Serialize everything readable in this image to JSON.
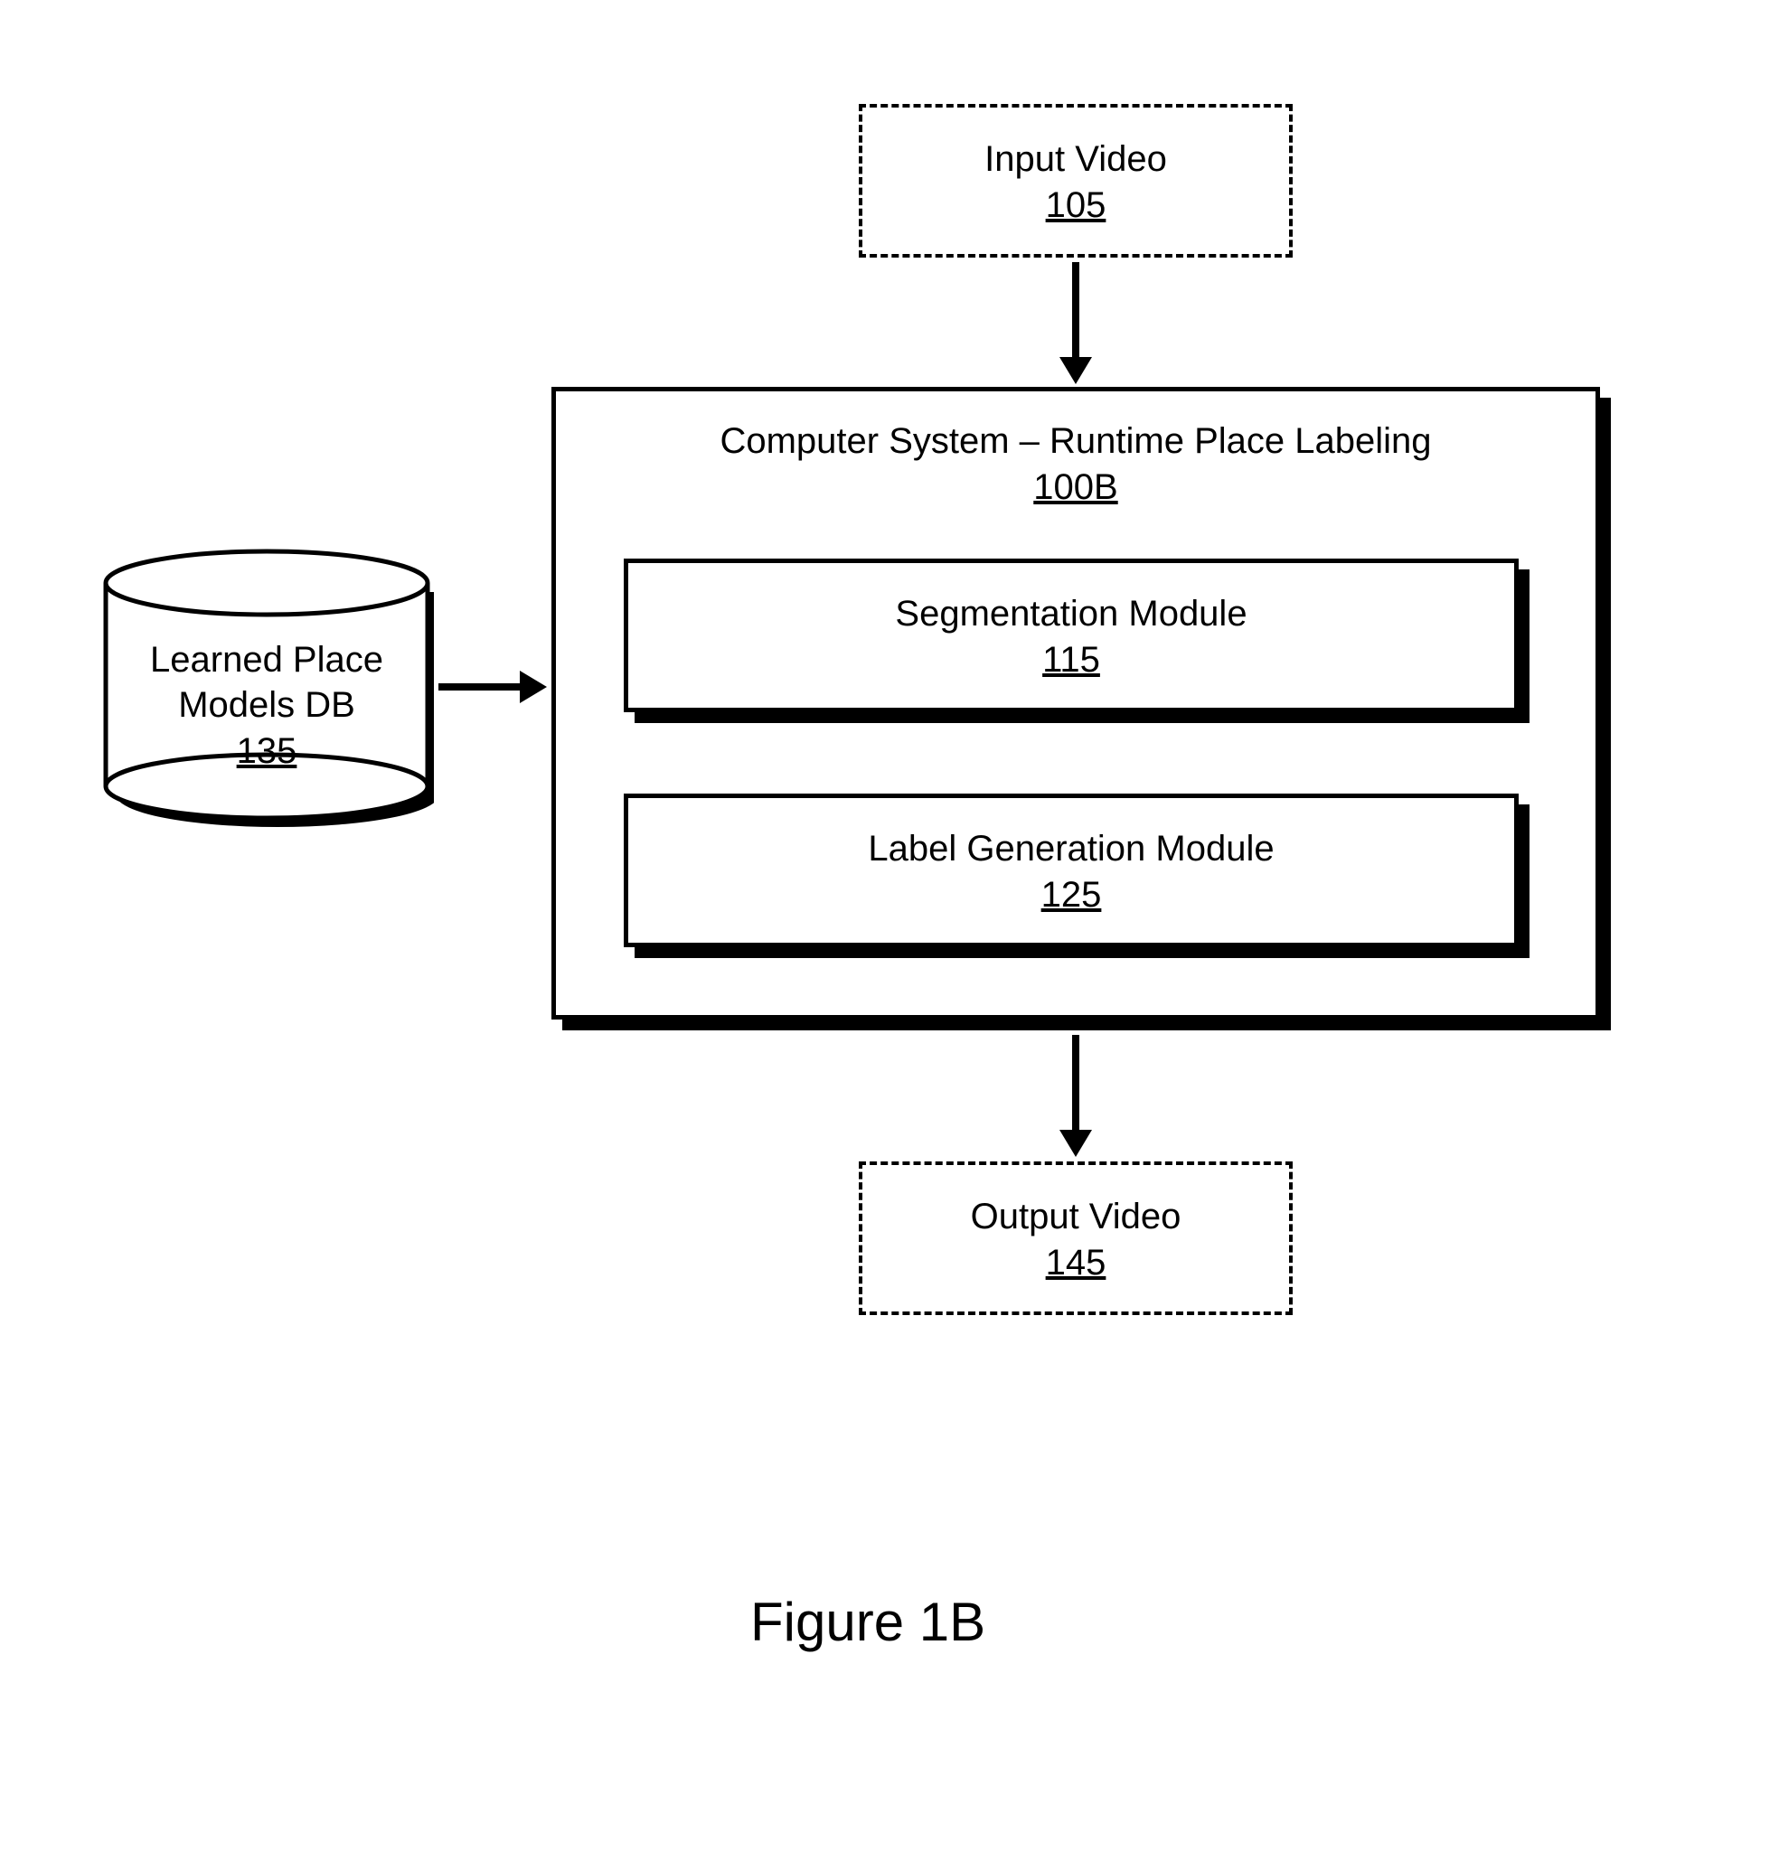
{
  "input_video": {
    "label": "Input Video",
    "ref": "105"
  },
  "system": {
    "label": "Computer System – Runtime Place Labeling",
    "ref": "100B",
    "segmentation": {
      "label": "Segmentation Module",
      "ref": "115"
    },
    "labelgen": {
      "label": "Label Generation Module",
      "ref": "125"
    }
  },
  "db": {
    "label_line1": "Learned Place",
    "label_line2": "Models DB",
    "ref": "135"
  },
  "output_video": {
    "label": "Output Video",
    "ref": "145"
  },
  "figure_caption": "Figure 1B"
}
